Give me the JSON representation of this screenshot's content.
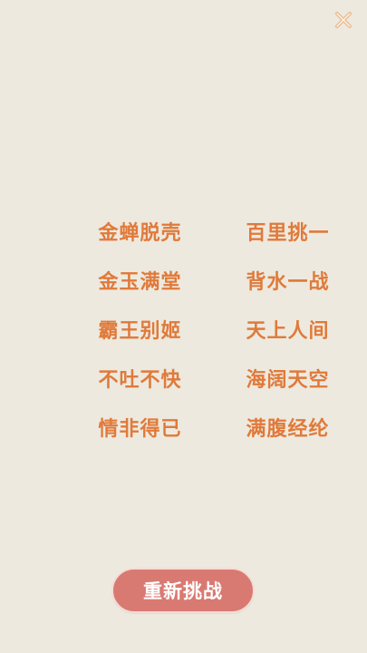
{
  "close_icon": "close-icon",
  "colors": {
    "background": "#ede9df",
    "idiom_text": "#e07a3a",
    "button_bg": "#d97a72",
    "button_border": "#f3ddd6",
    "close_icon": "#e8b98e"
  },
  "idioms": [
    "金蝉脱壳",
    "百里挑一",
    "金玉满堂",
    "背水一战",
    "霸王别姬",
    "天上人间",
    "不吐不快",
    "海阔天空",
    "情非得已",
    "满腹经纶"
  ],
  "retry_button": {
    "label": "重新挑战"
  }
}
